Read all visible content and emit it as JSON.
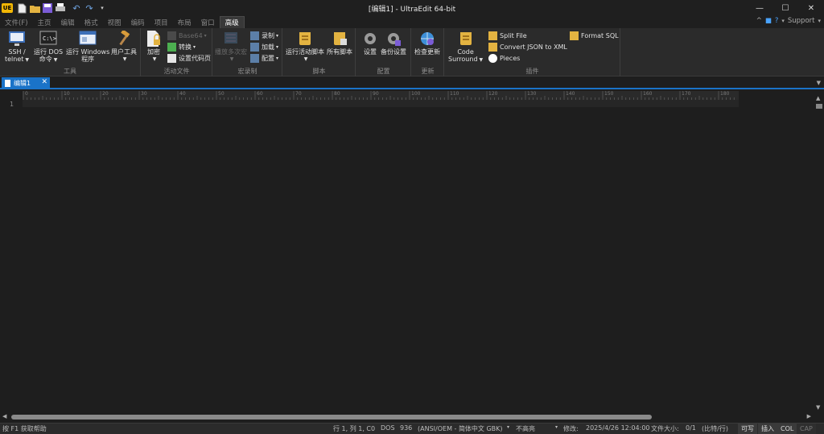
{
  "window": {
    "title": "[编辑1] - UltraEdit 64-bit",
    "app_logo_text": "UE",
    "minimize": "—",
    "maximize": "☐",
    "close": "✕"
  },
  "menu": {
    "tabs": [
      "文件(F)",
      "主页",
      "编辑",
      "格式",
      "视图",
      "编码",
      "项目",
      "布局",
      "窗口",
      "高级"
    ],
    "active_index": 9,
    "support_label": "Support"
  },
  "ribbon": {
    "groups": {
      "tools": {
        "label": "工具",
        "ssh": "SSH /",
        "ssh2": "telnet",
        "dos": "运行 DOS",
        "dos2": "命令",
        "windows": "运行 Windows",
        "windows2": "程序",
        "usertools": "用户工具"
      },
      "active_file": {
        "label": "活动文件",
        "encrypt": "加密",
        "base64": "Base64",
        "convert": "转换",
        "set_codepage": "设置代码页"
      },
      "macro": {
        "label": "宏录制",
        "play_multiple": "播放多次宏",
        "record": "录制",
        "load": "加载",
        "configure": "配置"
      },
      "script": {
        "label": "脚本",
        "run_active": "运行活动脚本",
        "all_scripts": "所有脚本"
      },
      "config": {
        "label": "配置",
        "settings": "设置",
        "backup": "备份设置"
      },
      "update": {
        "label": "更新",
        "check": "检查更新"
      },
      "plugins": {
        "label": "插件",
        "code_surround": "Code",
        "code_surround2": "Surround",
        "split_file": "Split File",
        "json_to_xml": "Convert JSON to XML",
        "pieces": "Pieces",
        "format_sql": "Format SQL"
      }
    }
  },
  "document": {
    "tab_label": "编辑1",
    "close": "✕",
    "line_number": "1"
  },
  "ruler": [
    "0",
    "10",
    "20",
    "30",
    "40",
    "50",
    "60",
    "70",
    "80",
    "90",
    "100",
    "110",
    "120",
    "130",
    "140",
    "150",
    "160",
    "170",
    "180"
  ],
  "status": {
    "help": "按 F1 获取帮助",
    "position": "行 1, 列 1, C0",
    "line_ending": "DOS",
    "codepage_num": "936",
    "codepage": "(ANSI/OEM - 简体中文 GBK)",
    "highlight": "不高亮",
    "modified": "修改:",
    "modified_date": "2025/4/26 12:04:00",
    "filesize": "文件大小:",
    "filesize_val": "0/1",
    "filesize_unit": "(比特/行)",
    "writable": "可写",
    "insert": "插入",
    "col": "COL",
    "cap": "CAP"
  }
}
